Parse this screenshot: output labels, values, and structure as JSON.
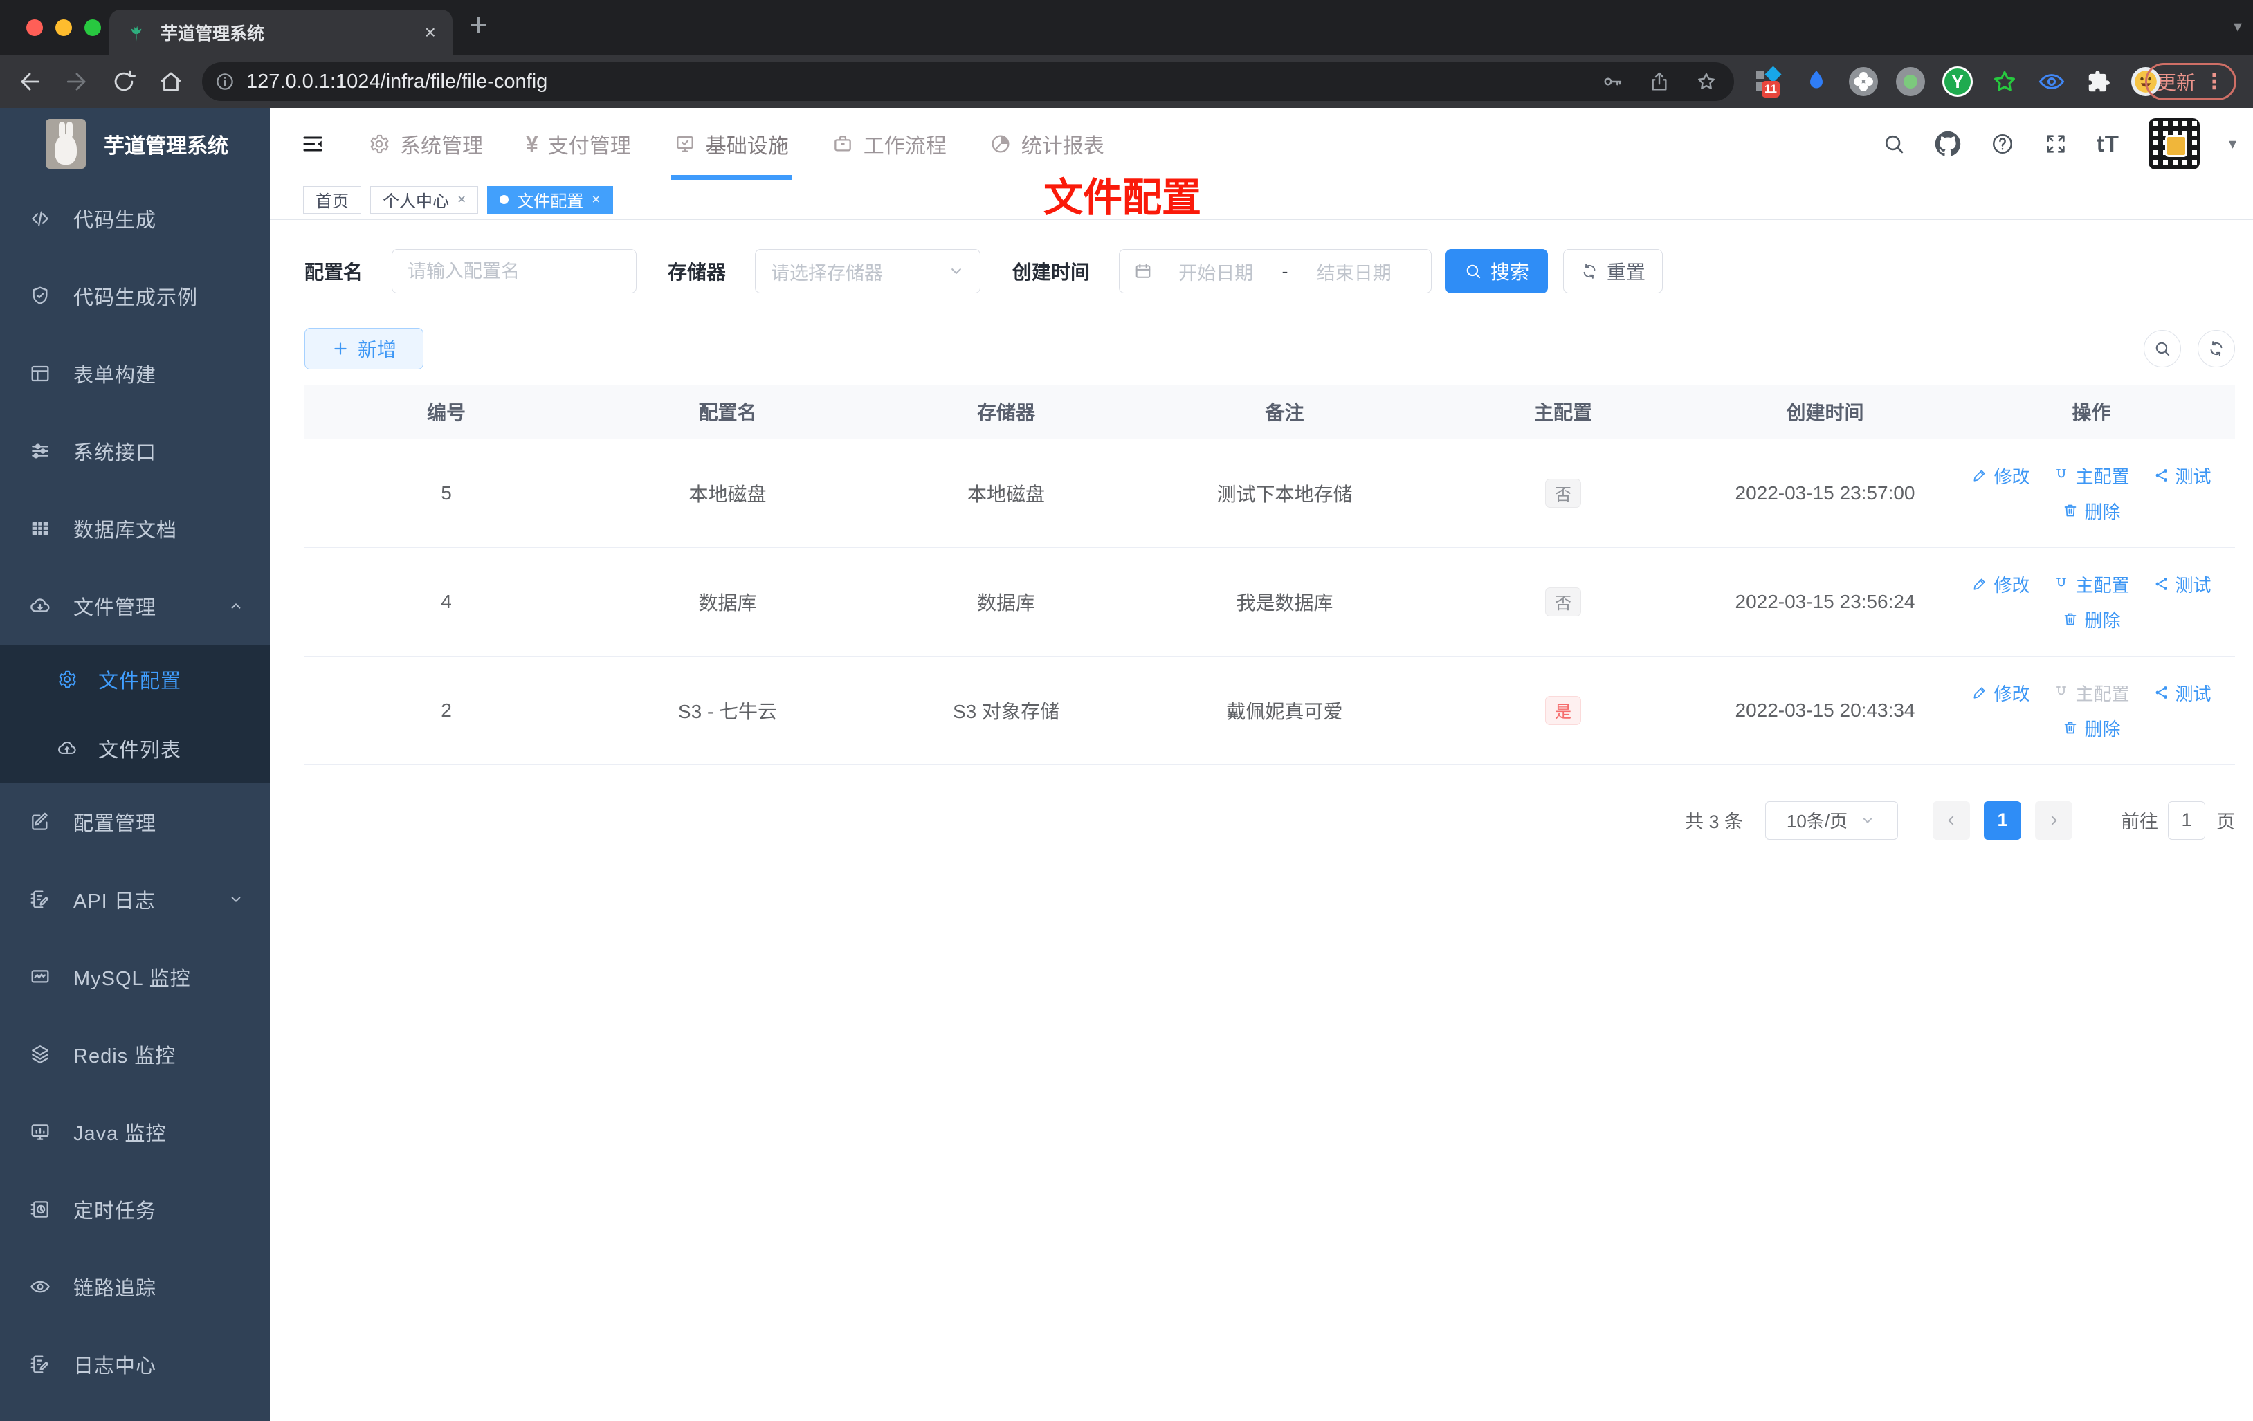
{
  "colors": {
    "accent_blue": "#409eff",
    "danger_red": "#f56c6c",
    "annotation_red": "#fa1a0a",
    "sidebar_bg": "#304156",
    "sidebar_submenu_bg": "#1f2d3d",
    "chrome_dark": "#202124"
  },
  "icons": {
    "yen": "¥",
    "font_size": "tT",
    "plus_tab": "+",
    "close": "×",
    "caret_down": "▾",
    "kebab": "⋮",
    "range_separator": "-"
  },
  "browser": {
    "tab_title": "芋道管理系统",
    "url": "127.0.0.1:1024/infra/file/file-config",
    "update_label": "更新",
    "extensions_badge": "11"
  },
  "sidebar": {
    "logo_title": "芋道管理系统",
    "items": [
      {
        "label": "代码生成",
        "icon": "code-icon"
      },
      {
        "label": "代码生成示例",
        "icon": "shield-check-icon"
      },
      {
        "label": "表单构建",
        "icon": "form-grid-icon"
      },
      {
        "label": "系统接口",
        "icon": "sliders-icon"
      },
      {
        "label": "数据库文档",
        "icon": "table-filled-icon"
      },
      {
        "label": "文件管理",
        "icon": "cloud-download-icon"
      },
      {
        "label": "配置管理",
        "icon": "edit-square-icon"
      },
      {
        "label": "API 日志",
        "icon": "doc-edit-icon"
      },
      {
        "label": "MySQL 监控",
        "icon": "chart-monitor-icon"
      },
      {
        "label": "Redis 监控",
        "icon": "layers-icon"
      },
      {
        "label": "Java 监控",
        "icon": "monitor-icon"
      },
      {
        "label": "定时任务",
        "icon": "task-clock-icon"
      },
      {
        "label": "链路追踪",
        "icon": "eye-icon"
      },
      {
        "label": "日志中心",
        "icon": "log-edit-icon"
      }
    ],
    "submenu": [
      {
        "label": "文件配置",
        "icon": "gear-icon",
        "active": true
      },
      {
        "label": "文件列表",
        "icon": "cloud-upload-icon"
      }
    ]
  },
  "topnav": {
    "items": [
      {
        "label": "系统管理",
        "icon": "gear-icon"
      },
      {
        "label": "支付管理",
        "icon": "yen-icon"
      },
      {
        "label": "基础设施",
        "icon": "monitor-check-icon",
        "active": true
      },
      {
        "label": "工作流程",
        "icon": "briefcase-icon"
      },
      {
        "label": "统计报表",
        "icon": "pie-chart-icon"
      }
    ]
  },
  "tags": {
    "items": [
      {
        "label": "首页"
      },
      {
        "label": "个人中心",
        "closable": true
      },
      {
        "label": "文件配置",
        "closable": true,
        "active": true
      }
    ]
  },
  "annotation": {
    "text": "文件配置",
    "color": "#fa1a0a"
  },
  "filters": {
    "name_label": "配置名",
    "name_placeholder": "请输入配置名",
    "storage_label": "存储器",
    "storage_placeholder": "请选择存储器",
    "time_label": "创建时间",
    "start_placeholder": "开始日期",
    "end_placeholder": "结束日期",
    "search_label": "搜索",
    "reset_label": "重置"
  },
  "toolbar": {
    "add_label": "新增"
  },
  "table": {
    "headers": [
      "编号",
      "配置名",
      "存储器",
      "备注",
      "主配置",
      "创建时间",
      "操作"
    ],
    "actions": {
      "edit": "修改",
      "master": "主配置",
      "test": "测试",
      "delete": "删除"
    },
    "rows": [
      {
        "id": "5",
        "name": "本地磁盘",
        "storage": "本地磁盘",
        "remark": "测试下本地存储",
        "master": "否",
        "master_type": "info",
        "created": "2022-03-15 23:57:00",
        "master_action_disabled": false
      },
      {
        "id": "4",
        "name": "数据库",
        "storage": "数据库",
        "remark": "我是数据库",
        "master": "否",
        "master_type": "info",
        "created": "2022-03-15 23:56:24",
        "master_action_disabled": false
      },
      {
        "id": "2",
        "name": "S3 - 七牛云",
        "storage": "S3 对象存储",
        "remark": "戴佩妮真可爱",
        "master": "是",
        "master_type": "danger",
        "created": "2022-03-15 20:43:34",
        "master_action_disabled": true
      }
    ]
  },
  "pagination": {
    "total": "共 3 条",
    "page_size": "10条/页",
    "current": "1",
    "goto_label": "前往",
    "goto_value": "1",
    "page_suffix": "页"
  }
}
